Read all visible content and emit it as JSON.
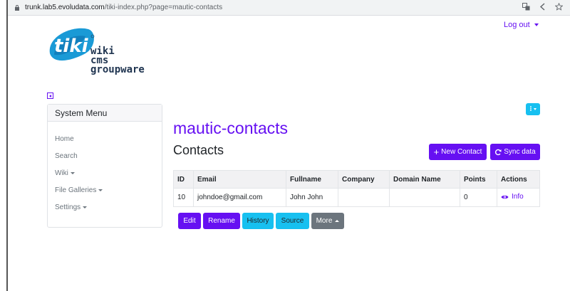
{
  "browser": {
    "url_host": "trunk.lab5.evoludata.com",
    "url_path": "/tiki-index.php?page=mautic-contacts",
    "icons": [
      "translate-icon",
      "share-icon",
      "star-icon"
    ]
  },
  "header": {
    "logout_label": "Log out",
    "logo": {
      "badge": "tiki",
      "line1": "wiki",
      "line2": "cms",
      "line3": "groupware"
    }
  },
  "sidebar": {
    "title": "System Menu",
    "items": [
      {
        "label": "Home",
        "has_caret": false
      },
      {
        "label": "Search",
        "has_caret": false
      },
      {
        "label": "Wiki",
        "has_caret": true
      },
      {
        "label": "File Galleries",
        "has_caret": true
      },
      {
        "label": "Settings",
        "has_caret": true
      }
    ]
  },
  "main": {
    "page_title": "mautic-contacts",
    "heading": "Contacts",
    "new_contact_label": "New Contact",
    "sync_label": "Sync data",
    "table": {
      "headers": [
        "ID",
        "Email",
        "Fullname",
        "Company",
        "Domain Name",
        "Points",
        "Actions"
      ],
      "rows": [
        {
          "id": "10",
          "email": "johndoe@gmail.com",
          "fullname": "John John",
          "company": "",
          "domain": "",
          "points": "0",
          "action": "Info"
        }
      ]
    },
    "page_actions": {
      "edit": "Edit",
      "rename": "Rename",
      "history": "History",
      "source": "Source",
      "more": "More"
    }
  },
  "colors": {
    "accent": "#6610f2",
    "info": "#17c0f0",
    "secondary": "#6c757d"
  }
}
